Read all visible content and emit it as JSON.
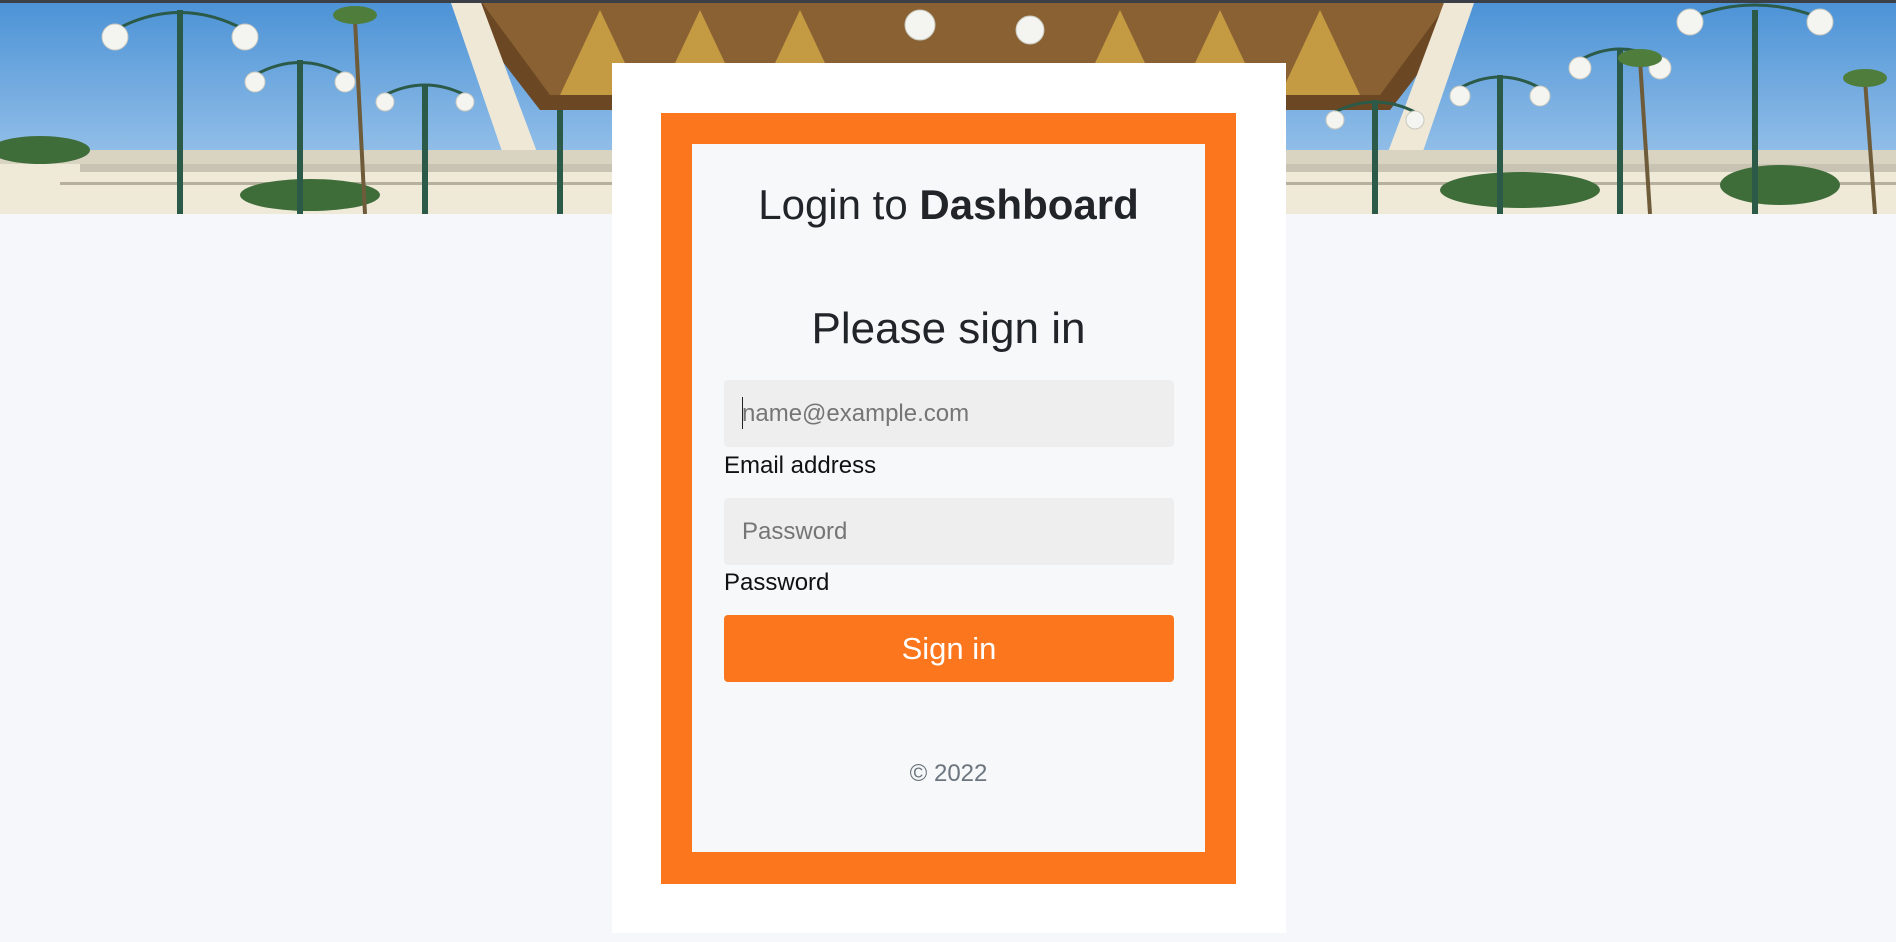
{
  "login": {
    "title_prefix": "Login to",
    "title_emphasis": "Dashboard",
    "heading": "Please sign in",
    "email": {
      "placeholder": "name@example.com",
      "label": "Email address",
      "value": ""
    },
    "password": {
      "placeholder": "Password",
      "label": "Password",
      "value": ""
    },
    "submit_label": "Sign in",
    "copyright": "© 2022"
  },
  "colors": {
    "accent": "#fb761c",
    "page_background": "#f5f7fa",
    "card_background": "#f6f8fa",
    "input_background": "#eeeeee"
  }
}
